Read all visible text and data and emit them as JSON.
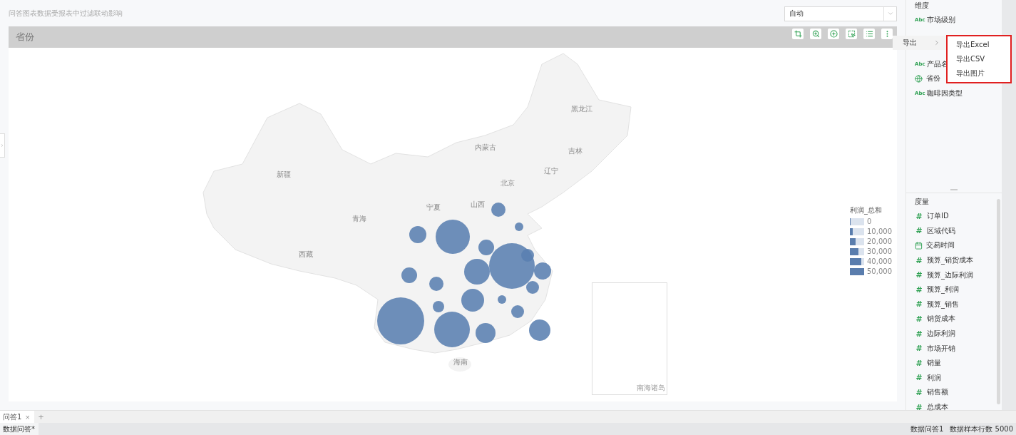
{
  "notice": "问答图表数据受报表中过滤联动影响",
  "mode_select": {
    "value": "自动"
  },
  "chart": {
    "header_title": "省份",
    "toolbar": [
      {
        "kind": "crop"
      },
      {
        "kind": "zoom"
      },
      {
        "kind": "add"
      },
      {
        "kind": "select"
      },
      {
        "kind": "list"
      },
      {
        "kind": "more"
      }
    ],
    "region_labels": [
      "新疆",
      "西藏",
      "青海",
      "内蒙古",
      "黑龙江",
      "吉林",
      "辽宁",
      "北京",
      "山西",
      "宁夏",
      "海南"
    ],
    "inset_label": "南海诸岛",
    "legend": {
      "title": "利润_总和",
      "items": [
        {
          "label": "0",
          "level": 0
        },
        {
          "label": "10,000",
          "level": 0.2
        },
        {
          "label": "20,000",
          "level": 0.4
        },
        {
          "label": "30,000",
          "level": 0.6
        },
        {
          "label": "40,000",
          "level": 0.8
        },
        {
          "label": "50,000",
          "level": 1
        }
      ]
    }
  },
  "export_menu": {
    "label": "导出",
    "submenu": [
      "导出Excel",
      "导出CSV",
      "导出图片"
    ]
  },
  "dimensions": {
    "title": "维度",
    "items": [
      {
        "kind": "text",
        "badge": "Abc",
        "label": "市场级别"
      },
      {
        "kind": "text",
        "badge": "Abc",
        "label": "产品名"
      },
      {
        "kind": "geo",
        "label": "省份"
      },
      {
        "kind": "text",
        "badge": "Abc",
        "label": "咖啡因类型"
      }
    ]
  },
  "measures": {
    "title": "度量",
    "items": [
      {
        "kind": "number",
        "badge": "#",
        "label": "订单ID"
      },
      {
        "kind": "number",
        "badge": "#",
        "label": "区域代码"
      },
      {
        "kind": "date",
        "label": "交易时间"
      },
      {
        "kind": "number",
        "badge": "#",
        "label": "预算_销货成本"
      },
      {
        "kind": "number",
        "badge": "#",
        "label": "预算_边际利润"
      },
      {
        "kind": "number",
        "badge": "#",
        "label": "预算_利润"
      },
      {
        "kind": "number",
        "badge": "#",
        "label": "预算_销售"
      },
      {
        "kind": "number",
        "badge": "#",
        "label": "销货成本"
      },
      {
        "kind": "number",
        "badge": "#",
        "label": "边际利润"
      },
      {
        "kind": "number",
        "badge": "#",
        "label": "市场开销"
      },
      {
        "kind": "number",
        "badge": "#",
        "label": "销量"
      },
      {
        "kind": "number",
        "badge": "#",
        "label": "利润"
      },
      {
        "kind": "number",
        "badge": "#",
        "label": "销售额"
      },
      {
        "kind": "number",
        "badge": "#",
        "label": "总成本"
      }
    ]
  },
  "tabs": [
    {
      "label": "问答1",
      "close": "×",
      "selected": true
    }
  ],
  "add_tab": "+",
  "status_bar": {
    "left": "数据问答*",
    "right": [
      "数据问答1",
      "数据样本行数 5000"
    ]
  }
}
